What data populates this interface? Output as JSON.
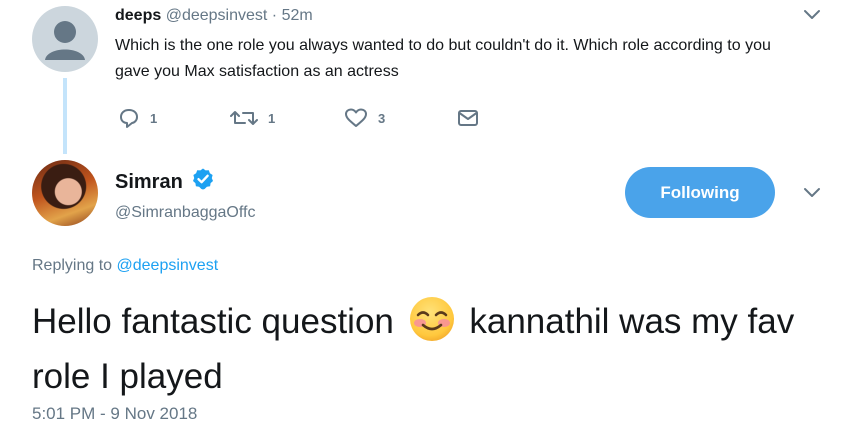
{
  "parent_tweet": {
    "name": "deeps",
    "handle": "@deepsinvest",
    "separator": "·",
    "time": "52m",
    "text": "Which is the one role you always wanted to do but couldn't do it. Which role according to you gave you Max satisfaction as an actress",
    "reply_count": "1",
    "retweet_count": "1",
    "like_count": "3"
  },
  "main_tweet": {
    "name": "Simran",
    "handle": "@SimranbaggaOffc",
    "follow_label": "Following",
    "replying_prefix": "Replying to",
    "replying_to": "@deepsinvest",
    "text_before_emoji": "Hello fantastic question",
    "text_after_emoji": "kannathil was my fav role I played",
    "timestamp": "5:01 PM - 9 Nov 2018"
  },
  "icons": {
    "caret": "chevron-down-icon",
    "reply": "reply-icon",
    "retweet": "retweet-icon",
    "like": "heart-icon",
    "dm": "envelope-icon",
    "verified": "verified-badge-icon",
    "emoji": "smiling-face-with-smiling-eyes-emoji"
  },
  "colors": {
    "accent": "#1da1f2",
    "follow_button": "#4aa3ea",
    "secondary_text": "#657786",
    "thread_line": "#c4e4fb"
  }
}
